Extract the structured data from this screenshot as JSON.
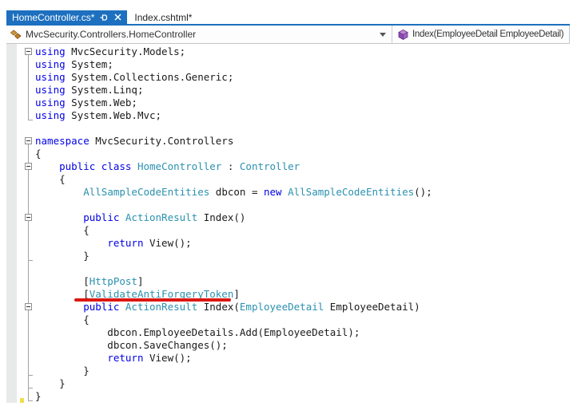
{
  "window": {
    "app": "Visual Studio code editor"
  },
  "tabs": [
    {
      "label": "HomeController.cs*",
      "active": true
    },
    {
      "label": "Index.cshtml*",
      "active": false
    }
  ],
  "navbar": {
    "left_combo": {
      "icon": "class-icon",
      "text": "MvcSecurity.Controllers.HomeController"
    },
    "right_combo": {
      "icon": "method-icon",
      "text": "Index(EmployeeDetail EmployeeDetail)"
    }
  },
  "colors": {
    "accent_blue": "#1d70bf",
    "keyword_blue": "#0000e6",
    "type_teal": "#2b91af",
    "plain_text": "#1a1a1a",
    "annotation_red": "#dc1712",
    "change_mark_yellow": "#f2de49"
  },
  "editor": {
    "lines": [
      [
        [
          "kw",
          "using"
        ],
        [
          "pl",
          " MvcSecurity.Models;"
        ]
      ],
      [
        [
          "kw",
          "using"
        ],
        [
          "pl",
          " System;"
        ]
      ],
      [
        [
          "kw",
          "using"
        ],
        [
          "pl",
          " System.Collections.Generic;"
        ]
      ],
      [
        [
          "kw",
          "using"
        ],
        [
          "pl",
          " System.Linq;"
        ]
      ],
      [
        [
          "kw",
          "using"
        ],
        [
          "pl",
          " System.Web;"
        ]
      ],
      [
        [
          "kw",
          "using"
        ],
        [
          "pl",
          " System.Web.Mvc;"
        ]
      ],
      [],
      [
        [
          "kw",
          "namespace"
        ],
        [
          "pl",
          " MvcSecurity.Controllers"
        ]
      ],
      [
        [
          "pl",
          "{"
        ]
      ],
      [
        [
          "pl",
          "    "
        ],
        [
          "kw",
          "public class"
        ],
        [
          "pl",
          " "
        ],
        [
          "ty",
          "HomeController"
        ],
        [
          "pl",
          " : "
        ],
        [
          "ty",
          "Controller"
        ]
      ],
      [
        [
          "pl",
          "    {"
        ]
      ],
      [
        [
          "pl",
          "        "
        ],
        [
          "ty",
          "AllSampleCodeEntities"
        ],
        [
          "pl",
          " dbcon = "
        ],
        [
          "kw",
          "new"
        ],
        [
          "pl",
          " "
        ],
        [
          "ty",
          "AllSampleCodeEntities"
        ],
        [
          "pl",
          "();"
        ]
      ],
      [],
      [
        [
          "pl",
          "        "
        ],
        [
          "kw",
          "public"
        ],
        [
          "pl",
          " "
        ],
        [
          "ty",
          "ActionResult"
        ],
        [
          "pl",
          " Index()"
        ]
      ],
      [
        [
          "pl",
          "        {"
        ]
      ],
      [
        [
          "pl",
          "            "
        ],
        [
          "kw",
          "return"
        ],
        [
          "pl",
          " View();"
        ]
      ],
      [
        [
          "pl",
          "        }"
        ]
      ],
      [],
      [
        [
          "pl",
          "        ["
        ],
        [
          "ty",
          "HttpPost"
        ],
        [
          "pl",
          "]"
        ]
      ],
      [
        [
          "pl",
          "        ["
        ],
        [
          "ty",
          "ValidateAntiForgeryToken"
        ],
        [
          "pl",
          "]"
        ]
      ],
      [
        [
          "pl",
          "        "
        ],
        [
          "kw",
          "public"
        ],
        [
          "pl",
          " "
        ],
        [
          "ty",
          "ActionResult"
        ],
        [
          "pl",
          " Index("
        ],
        [
          "ty",
          "EmployeeDetail"
        ],
        [
          "pl",
          " EmployeeDetail)"
        ]
      ],
      [
        [
          "pl",
          "        {"
        ]
      ],
      [
        [
          "pl",
          "            dbcon.EmployeeDetails.Add(EmployeeDetail);"
        ]
      ],
      [
        [
          "pl",
          "            dbcon.SaveChanges();"
        ]
      ],
      [
        [
          "pl",
          "            "
        ],
        [
          "kw",
          "return"
        ],
        [
          "pl",
          " View();"
        ]
      ],
      [
        [
          "pl",
          "        }"
        ]
      ],
      [
        [
          "pl",
          "    }"
        ]
      ],
      [
        [
          "pl",
          "}"
        ]
      ]
    ],
    "outline": {
      "box_lines": [
        1,
        8,
        10,
        14,
        21
      ],
      "tick_lines": [
        6,
        17,
        26,
        27,
        28
      ],
      "segments": [
        {
          "from": 1,
          "to": 6
        },
        {
          "from": 8,
          "to": 28
        }
      ]
    },
    "annotation": {
      "type": "red-underline",
      "target_line": 20,
      "target_text": "[ValidateAntiForgeryToken]"
    }
  }
}
